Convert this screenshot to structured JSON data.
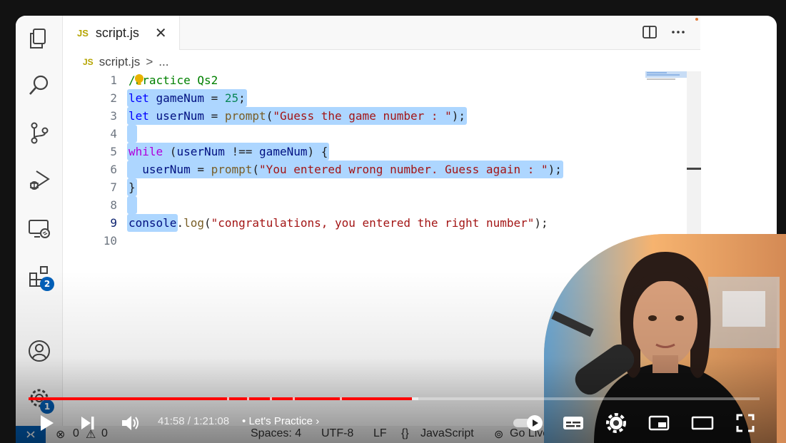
{
  "editor": {
    "tab": {
      "lang_badge": "JS",
      "filename": "script.js",
      "close_glyph": "✕"
    },
    "breadcrumb": {
      "lang_badge": "JS",
      "file": "script.js",
      "separator": ">",
      "more": "..."
    },
    "activity_badges": {
      "extensions": "2",
      "settings": "1"
    },
    "lines": [
      {
        "n": "1",
        "tokens": [
          [
            "cmt",
            "/"
          ],
          [
            "cmt",
            "Practice Qs2"
          ]
        ]
      },
      {
        "n": "2",
        "tokens": [
          [
            "kw",
            "let"
          ],
          [
            "",
            " "
          ],
          [
            "var",
            "gameNum"
          ],
          [
            "",
            " = "
          ],
          [
            "num",
            "25"
          ],
          [
            "",
            ";"
          ]
        ]
      },
      {
        "n": "3",
        "tokens": [
          [
            "kw",
            "let"
          ],
          [
            "",
            " "
          ],
          [
            "var",
            "userNum"
          ],
          [
            "",
            " = "
          ],
          [
            "fn",
            "prompt"
          ],
          [
            "",
            "("
          ],
          [
            "str",
            "\"Guess the game number : \""
          ],
          [
            "",
            ");"
          ]
        ]
      },
      {
        "n": "4",
        "tokens": []
      },
      {
        "n": "5",
        "tokens": [
          [
            "ctl",
            "while"
          ],
          [
            "",
            " ("
          ],
          [
            "var",
            "userNum"
          ],
          [
            "",
            " !== "
          ],
          [
            "var",
            "gameNum"
          ],
          [
            "",
            ") {"
          ]
        ]
      },
      {
        "n": "6",
        "tokens": [
          [
            "",
            "  "
          ],
          [
            "var",
            "userNum"
          ],
          [
            "",
            " = "
          ],
          [
            "fn",
            "prompt"
          ],
          [
            "",
            "("
          ],
          [
            "str",
            "\"You entered wrong number. Guess again : \""
          ],
          [
            "",
            ");"
          ]
        ]
      },
      {
        "n": "7",
        "tokens": [
          [
            "",
            "}"
          ]
        ]
      },
      {
        "n": "8",
        "tokens": []
      },
      {
        "n": "9",
        "tokens": [
          [
            "var",
            "console"
          ],
          [
            "",
            "."
          ],
          [
            "fn",
            "log"
          ],
          [
            "",
            "("
          ],
          [
            "str",
            "\"congratulations, you entered the right number\""
          ],
          [
            "",
            ");"
          ]
        ]
      },
      {
        "n": "10",
        "tokens": []
      }
    ]
  },
  "statusbar": {
    "errors": "0",
    "warnings": "0",
    "spaces": "Spaces: 4",
    "encoding": "UTF-8",
    "eol": "LF",
    "language": "JavaScript",
    "golive": "Go Live"
  },
  "player": {
    "time": "41:58 / 1:21:08",
    "chapter": "Let's Practice",
    "chapter_separator": "•",
    "progress_played_fraction": 0.524,
    "icons": [
      "play-icon",
      "next-icon",
      "volume-icon",
      "autoplay-toggle-icon",
      "subtitles-icon",
      "settings-icon",
      "miniplayer-icon",
      "theater-icon",
      "fullscreen-icon"
    ]
  },
  "colors": {
    "selection": "#add6ff",
    "keyword": "#0000ff",
    "control": "#af00db",
    "string": "#a31515",
    "number": "#098658",
    "variable": "#001080",
    "function": "#795e26",
    "comment": "#008000",
    "progress": "#ff0000",
    "badge": "#005fb8"
  }
}
